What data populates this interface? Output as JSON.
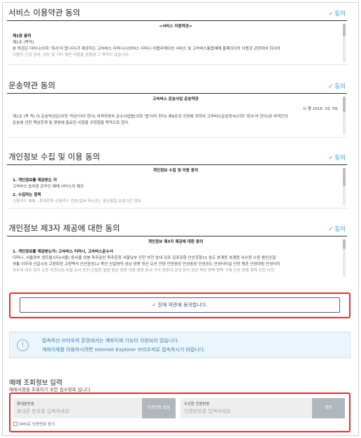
{
  "agree_label": "동의",
  "sections": [
    {
      "title": "서비스 이용약관 동의",
      "doc_title": "<서비스 이용약관>",
      "lines": [
        "제1장 총칙",
        "제1조 (목적)",
        "본 약관은 티머니(이하 '회사'라 합니다)가 제공하는 고속버스 티머니/시외버스 티머니 어플리케이션 서비스 및 고속버스통합예매 홈페이지의 이용과 관련하여 회사와",
        "이용자 간의 권리, 의무 및 기타 제반 사항을 정함에 그 목적이 있습니다."
      ]
    },
    {
      "title": "운송약관 동의",
      "doc_title": "고속버스 운송사업 운송약관",
      "date_line": "시 행 2016. 03. 09.",
      "lines": [
        "제1조 (목 적) 이 운송약관은(이하 '약관'이라 한다) 여객자동차 운수사업법(이하 '법'이라 한다) 제9조의 규정에 의하여 고속버스운송회사(이하 '회사'라 한다)와 여객간의",
        "운송에 관한 책임한계 및 경영에 필요한 사항을 규정함을 목적으로 한다."
      ]
    },
    {
      "title": "개인정보 수집 및 이용 동의",
      "doc_title": "개인정보 수집 및 이용 동의",
      "lines": [
        "1. 개인정보를 제공받는 자",
        "고속버스 승차권 온라인 예매 서비스의 제공",
        "2. 수집하는 항목",
        "신용카드 예매 - 휴대전화 신용카드 번호(일부 마스킹), 생년월일 유효기간 정보"
      ]
    },
    {
      "title": "개인정보 제3자 제공에 대한 동의",
      "doc_title": "개인정보 제3자 제공에 대한 동의",
      "lines": [
        "1. 개인정보를 제공받는자: 고속버스 티머니, 고속버스운수사",
        "티머니, 서울경부 센트럴시티(서울) 동서울 상봉 파주문산 파주운정 서울남부 인천 부천 송내 김포 김포공항 안산공항11 송도 호계동 호계원 서수원 수원 용인신갈",
        "영통 이주대 신갈시외 고양화정 고양백석 안산중앙12 죽전 신갈영덕 성남 광명 청산 오산 안양 안양중앙 안성중앙 안성공도 안성터미널 안양 평촌 안성대림 안성터미",
        "여주대 여주 양지 오천 이천시외 부발 능서 포천 신철원 철원 용문 양평 대원 용평 동서 구리 동동대 오대 원곡 양산 학양 평택 평택 구례 안산 양평 청파 이천 이천"
      ]
    }
  ],
  "agree_all": "전체 약관에 동의합니다.",
  "notice": {
    "icon": "exclamation-icon",
    "line1": "접속하신 브라우저 환경에서는 계좌이체 기능이 지원되지 않습니다.",
    "line2": "계좌이체를 이용하시려면 Internet Explorer 브라우저로 접속하시기 바랍니다."
  },
  "reservation": {
    "title": "예매 조회정보 입력",
    "subtitle": "예매사항을 조회하기 위한 필수항목 입니다.",
    "phone_label": "휴대폰번호",
    "phone_placeholder": "휴대폰 번호를 입력하세요",
    "send_button": "인증번호 발송",
    "code_label": "수신한 인증번호",
    "code_placeholder": "인증번호를 입력하세요",
    "confirm_button": "확인",
    "sms_label": "SMS로 인증번호 받기"
  },
  "colors": {
    "accent": "#3aa0d8",
    "highlight": "#e03030",
    "agree_all": "#4b4b90"
  }
}
